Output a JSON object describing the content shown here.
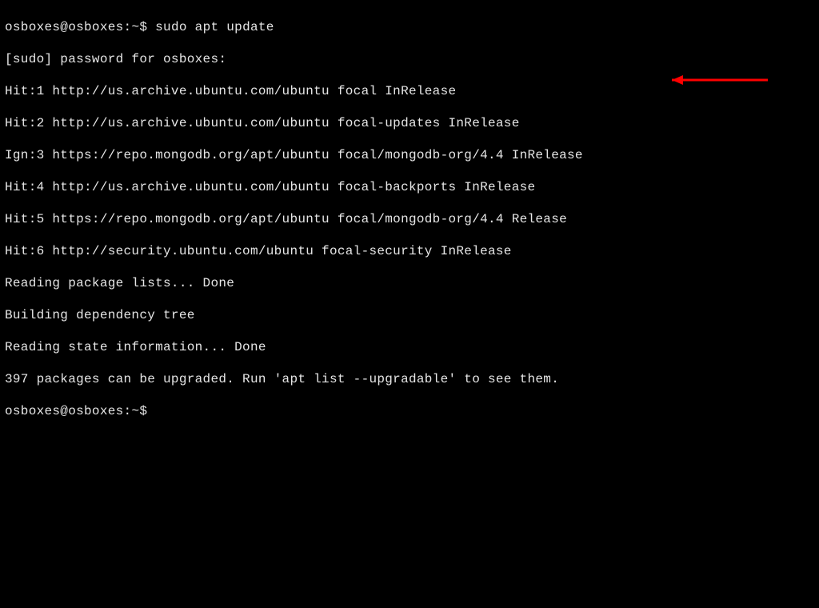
{
  "terminal": {
    "prompt1_user": "osboxes@osboxes:",
    "prompt1_path": "~",
    "prompt1_symbol": "$",
    "cmd1": "sudo apt update",
    "line_sudo": "[sudo] password for osboxes:",
    "line_hit1": "Hit:1 http://us.archive.ubuntu.com/ubuntu focal InRelease",
    "line_hit2": "Hit:2 http://us.archive.ubuntu.com/ubuntu focal-updates InRelease",
    "line_ign3": "Ign:3 https://repo.mongodb.org/apt/ubuntu focal/mongodb-org/4.4 InRelease",
    "line_hit4": "Hit:4 http://us.archive.ubuntu.com/ubuntu focal-backports InRelease",
    "line_hit5": "Hit:5 https://repo.mongodb.org/apt/ubuntu focal/mongodb-org/4.4 Release",
    "line_hit6": "Hit:6 http://security.ubuntu.com/ubuntu focal-security InRelease",
    "line_reading_pkg": "Reading package lists... Done",
    "line_building": "Building dependency tree",
    "line_reading_state": "Reading state information... Done",
    "line_upgradable": "397 packages can be upgraded. Run 'apt list --upgradable' to see them.",
    "prompt2_user": "osboxes@osboxes:",
    "prompt2_path": "~",
    "prompt2_symbol": "$"
  },
  "annotation": {
    "arrow_color": "#ff0000"
  }
}
